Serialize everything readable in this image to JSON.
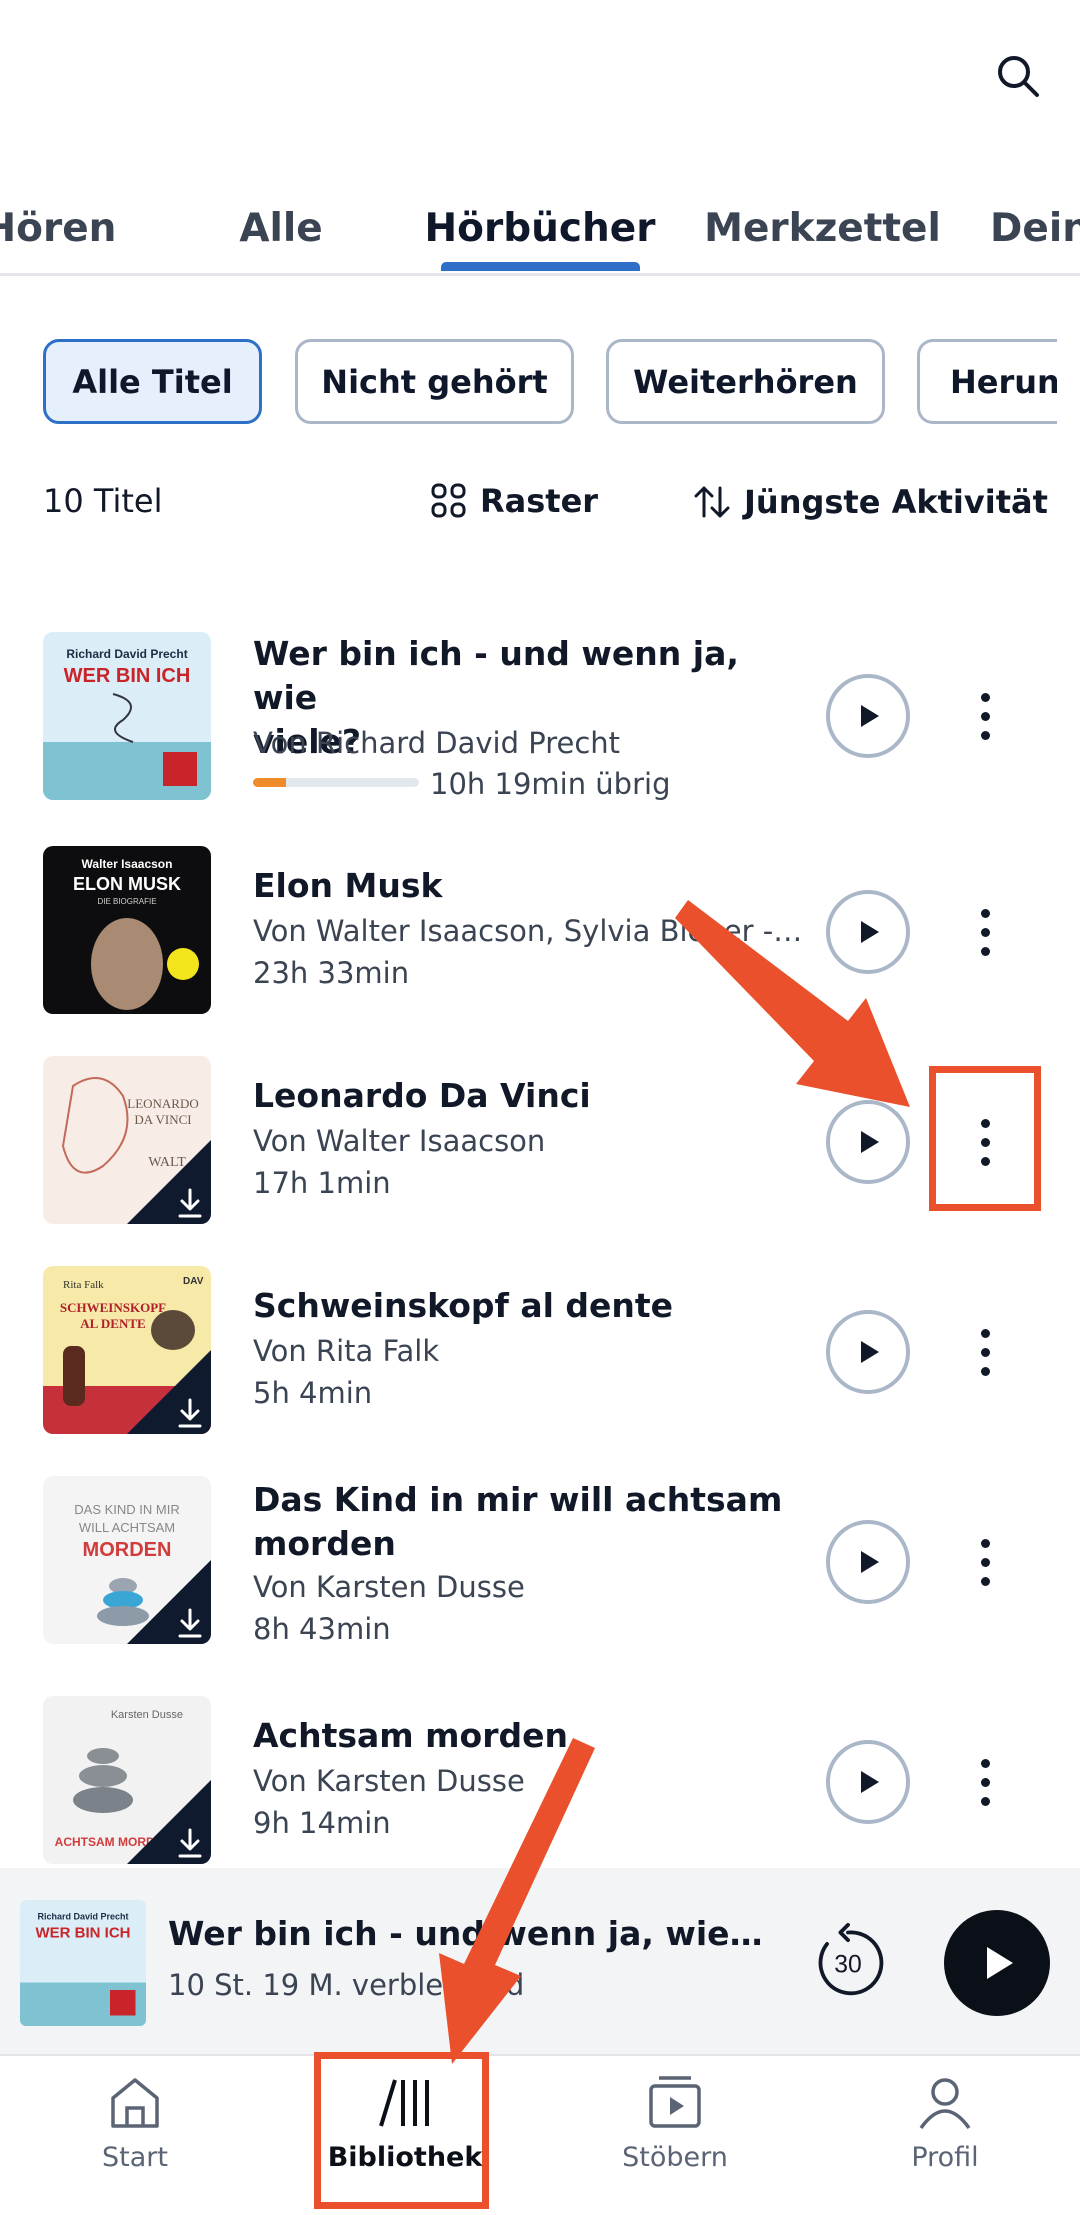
{
  "header": {
    "search_icon": "search-icon"
  },
  "tabs": [
    {
      "label": "Hören",
      "active": false
    },
    {
      "label": "Alle",
      "active": false
    },
    {
      "label": "Hörbücher",
      "active": true
    },
    {
      "label": "Merkzettel",
      "active": false
    },
    {
      "label": "Dein",
      "active": false
    }
  ],
  "filters": [
    {
      "label": "Alle Titel",
      "active": true
    },
    {
      "label": "Nicht gehört",
      "active": false
    },
    {
      "label": "Weiterhören",
      "active": false
    },
    {
      "label": "Herun",
      "active": false
    }
  ],
  "library": {
    "count_label": "10 Titel",
    "view_label": "Raster",
    "sort_label": "Jüngste Aktivität"
  },
  "books": [
    {
      "title_line1": "Wer bin ich - und wenn ja, wie",
      "title_line2": "viele?",
      "author": "Von Richard David Precht",
      "meta": "10h 19min übrig",
      "progress": 0.2,
      "downloaded": false
    },
    {
      "title_line1": "Elon Musk",
      "title_line2": "",
      "author": "Von Walter Isaacson, Sylvia Bieber - Üb...",
      "meta": "23h 33min",
      "downloaded": false
    },
    {
      "title_line1": "Leonardo Da Vinci",
      "title_line2": "",
      "author": "Von Walter Isaacson",
      "meta": "17h 1min",
      "downloaded": true
    },
    {
      "title_line1": "Schweinskopf al dente",
      "title_line2": "",
      "author": "Von Rita Falk",
      "meta": "5h 4min",
      "downloaded": true
    },
    {
      "title_line1": "Das Kind in mir will achtsam",
      "title_line2": "morden",
      "author": "Von Karsten Dusse",
      "meta": "8h 43min",
      "downloaded": true
    },
    {
      "title_line1": "Achtsam morden",
      "title_line2": "",
      "author": "Von Karsten Dusse",
      "meta": "9h 14min",
      "downloaded": true
    }
  ],
  "covers": {
    "precht": {
      "author": "Richard David Precht",
      "title": "WER BIN ICH"
    },
    "musk": {
      "author": "Walter Isaacson",
      "title": "ELON MUSK",
      "sub": "DIE BIOGRAFIE"
    },
    "davinci": {
      "title1": "LEONARDO",
      "title2": "DA VINCI",
      "author": "WALT"
    },
    "falk": {
      "author": "Rita Falk",
      "title1": "SCHWEINSKOPF",
      "title2": "AL DENTE",
      "brand": "DAV"
    },
    "kind": {
      "line1": "DAS KIND IN MIR",
      "line2": "WILL ACHTSAM",
      "line3": "MORDEN"
    },
    "achtsam": {
      "author": "Karsten Dusse",
      "title": "ACHTSAM MORDEN"
    }
  },
  "mini_player": {
    "title": "Wer bin ich - und wenn ja, wie viele...",
    "subtitle": "10 St. 19 M. verbleibend",
    "rewind_seconds": "30"
  },
  "bottom_nav": [
    {
      "label": "Start",
      "icon": "home-icon",
      "active": false
    },
    {
      "label": "Bibliothek",
      "icon": "library-icon",
      "active": true
    },
    {
      "label": "Stöbern",
      "icon": "browse-icon",
      "active": false
    },
    {
      "label": "Profil",
      "icon": "profile-icon",
      "active": false
    }
  ],
  "colors": {
    "accent": "#2e6fc8",
    "annotation": "#e9502b",
    "progress": "#f08b2c"
  }
}
